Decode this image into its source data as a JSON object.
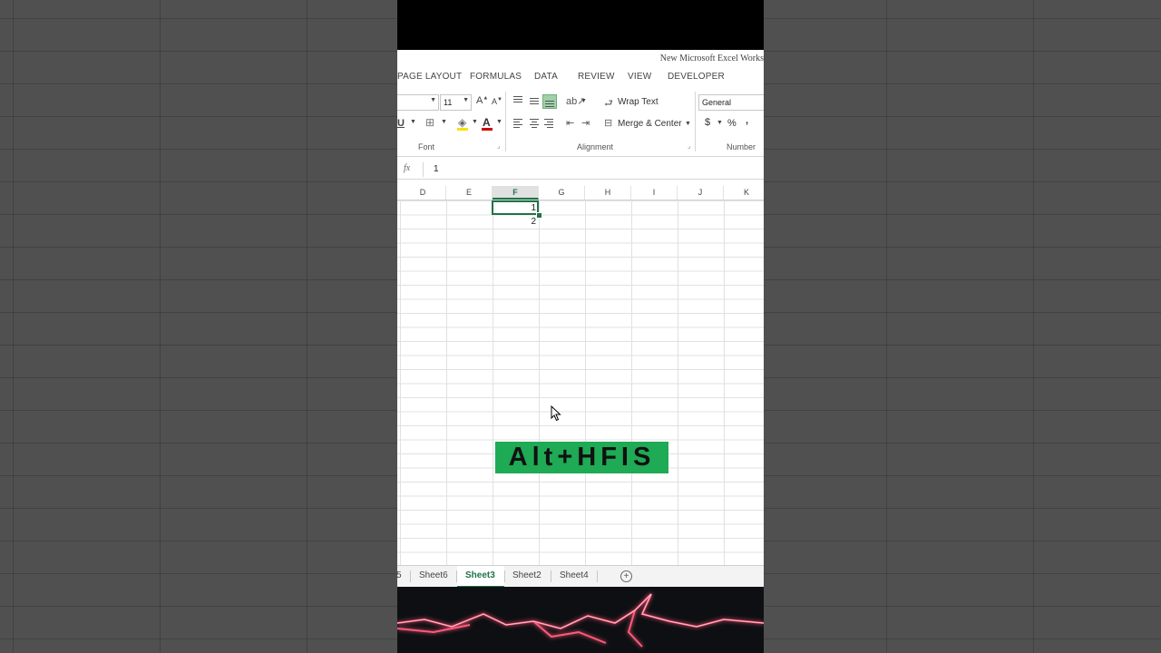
{
  "window": {
    "title": "New Microsoft Excel Works"
  },
  "tabs": [
    "PAGE LAYOUT",
    "FORMULAS",
    "DATA",
    "REVIEW",
    "VIEW",
    "DEVELOPER"
  ],
  "ribbon": {
    "font_size": "11",
    "font_group_label": "Font",
    "alignment_group_label": "Alignment",
    "number_group_label": "Number",
    "wrap_text": "Wrap Text",
    "merge_center": "Merge & Center",
    "number_format": "General",
    "currency_symbol": "$",
    "percent_symbol": "%",
    "comma_symbol": ",",
    "underline": "U",
    "font_color_letter": "A",
    "grow_font": "A",
    "shrink_font": "A"
  },
  "formula_bar": {
    "fx": "fx",
    "value": "1"
  },
  "columns": [
    "D",
    "E",
    "F",
    "G",
    "H",
    "I",
    "J",
    "K"
  ],
  "selected_column": "F",
  "cells": [
    {
      "ref": "F1",
      "value": "1"
    },
    {
      "ref": "F2",
      "value": "2"
    }
  ],
  "overlay": {
    "shortcut_text": "Alt+HFIS",
    "color": "#1faa55"
  },
  "sheet_tabs": {
    "partial": "5",
    "tabs": [
      "Sheet6",
      "Sheet3",
      "Sheet2",
      "Sheet4"
    ],
    "active": "Sheet3"
  },
  "colors": {
    "accent": "#217346"
  }
}
